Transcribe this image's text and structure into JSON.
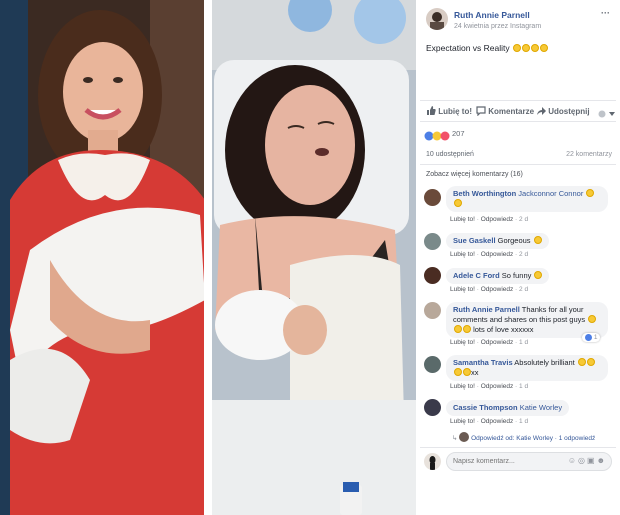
{
  "post": {
    "author": "Ruth Annie Parnell",
    "meta": "24 kwietnia przez Instagram",
    "more_label": "···",
    "text": "Expectation vs Reality",
    "text_emoji_count": 4
  },
  "actions": {
    "like": "Lubię to!",
    "comment": "Komentarze",
    "share": "Udostępnij"
  },
  "reactions": {
    "count": "207"
  },
  "stats": {
    "shares": "10 udostępnień",
    "comments": "22 komentarzy"
  },
  "more_comments": "Zobacz więcej komentarzy (16)",
  "comments": [
    {
      "author": "Beth Worthington",
      "tag": "Jackconnor Connor",
      "text": "",
      "like": "Lubię to!",
      "reply": "Odpowiedz",
      "time": "2 d"
    },
    {
      "author": "Sue Gaskell",
      "tag": "",
      "text": "Gorgeous",
      "like": "Lubię to!",
      "reply": "Odpowiedz",
      "time": "2 d"
    },
    {
      "author": "Adele C Ford",
      "tag": "",
      "text": "So funny",
      "like": "Lubię to!",
      "reply": "Odpowiedz",
      "time": "2 d"
    },
    {
      "author": "Ruth Annie Parnell",
      "tag": "",
      "text": "Thanks for all your comments and shares on this post guys",
      "text2": "lots of love xxxxxx",
      "like": "Lubię to!",
      "reply": "Odpowiedz",
      "time": "1 d",
      "likes": "1"
    },
    {
      "author": "Samantha Travis",
      "tag": "",
      "text": "Absolutely brilliant",
      "text2": "xx",
      "like": "Lubię to!",
      "reply": "Odpowiedz",
      "time": "1 d"
    },
    {
      "author": "Cassie Thompson",
      "tag": "Katie Worley",
      "text": "",
      "like": "Lubię to!",
      "reply": "Odpowiedz",
      "time": "1 d"
    }
  ],
  "reply_summary": {
    "text": "Odpowiedź od: Katie Worley",
    "count": "1 odpowiedź"
  },
  "composer": {
    "placeholder": "Napisz komentarz..."
  }
}
